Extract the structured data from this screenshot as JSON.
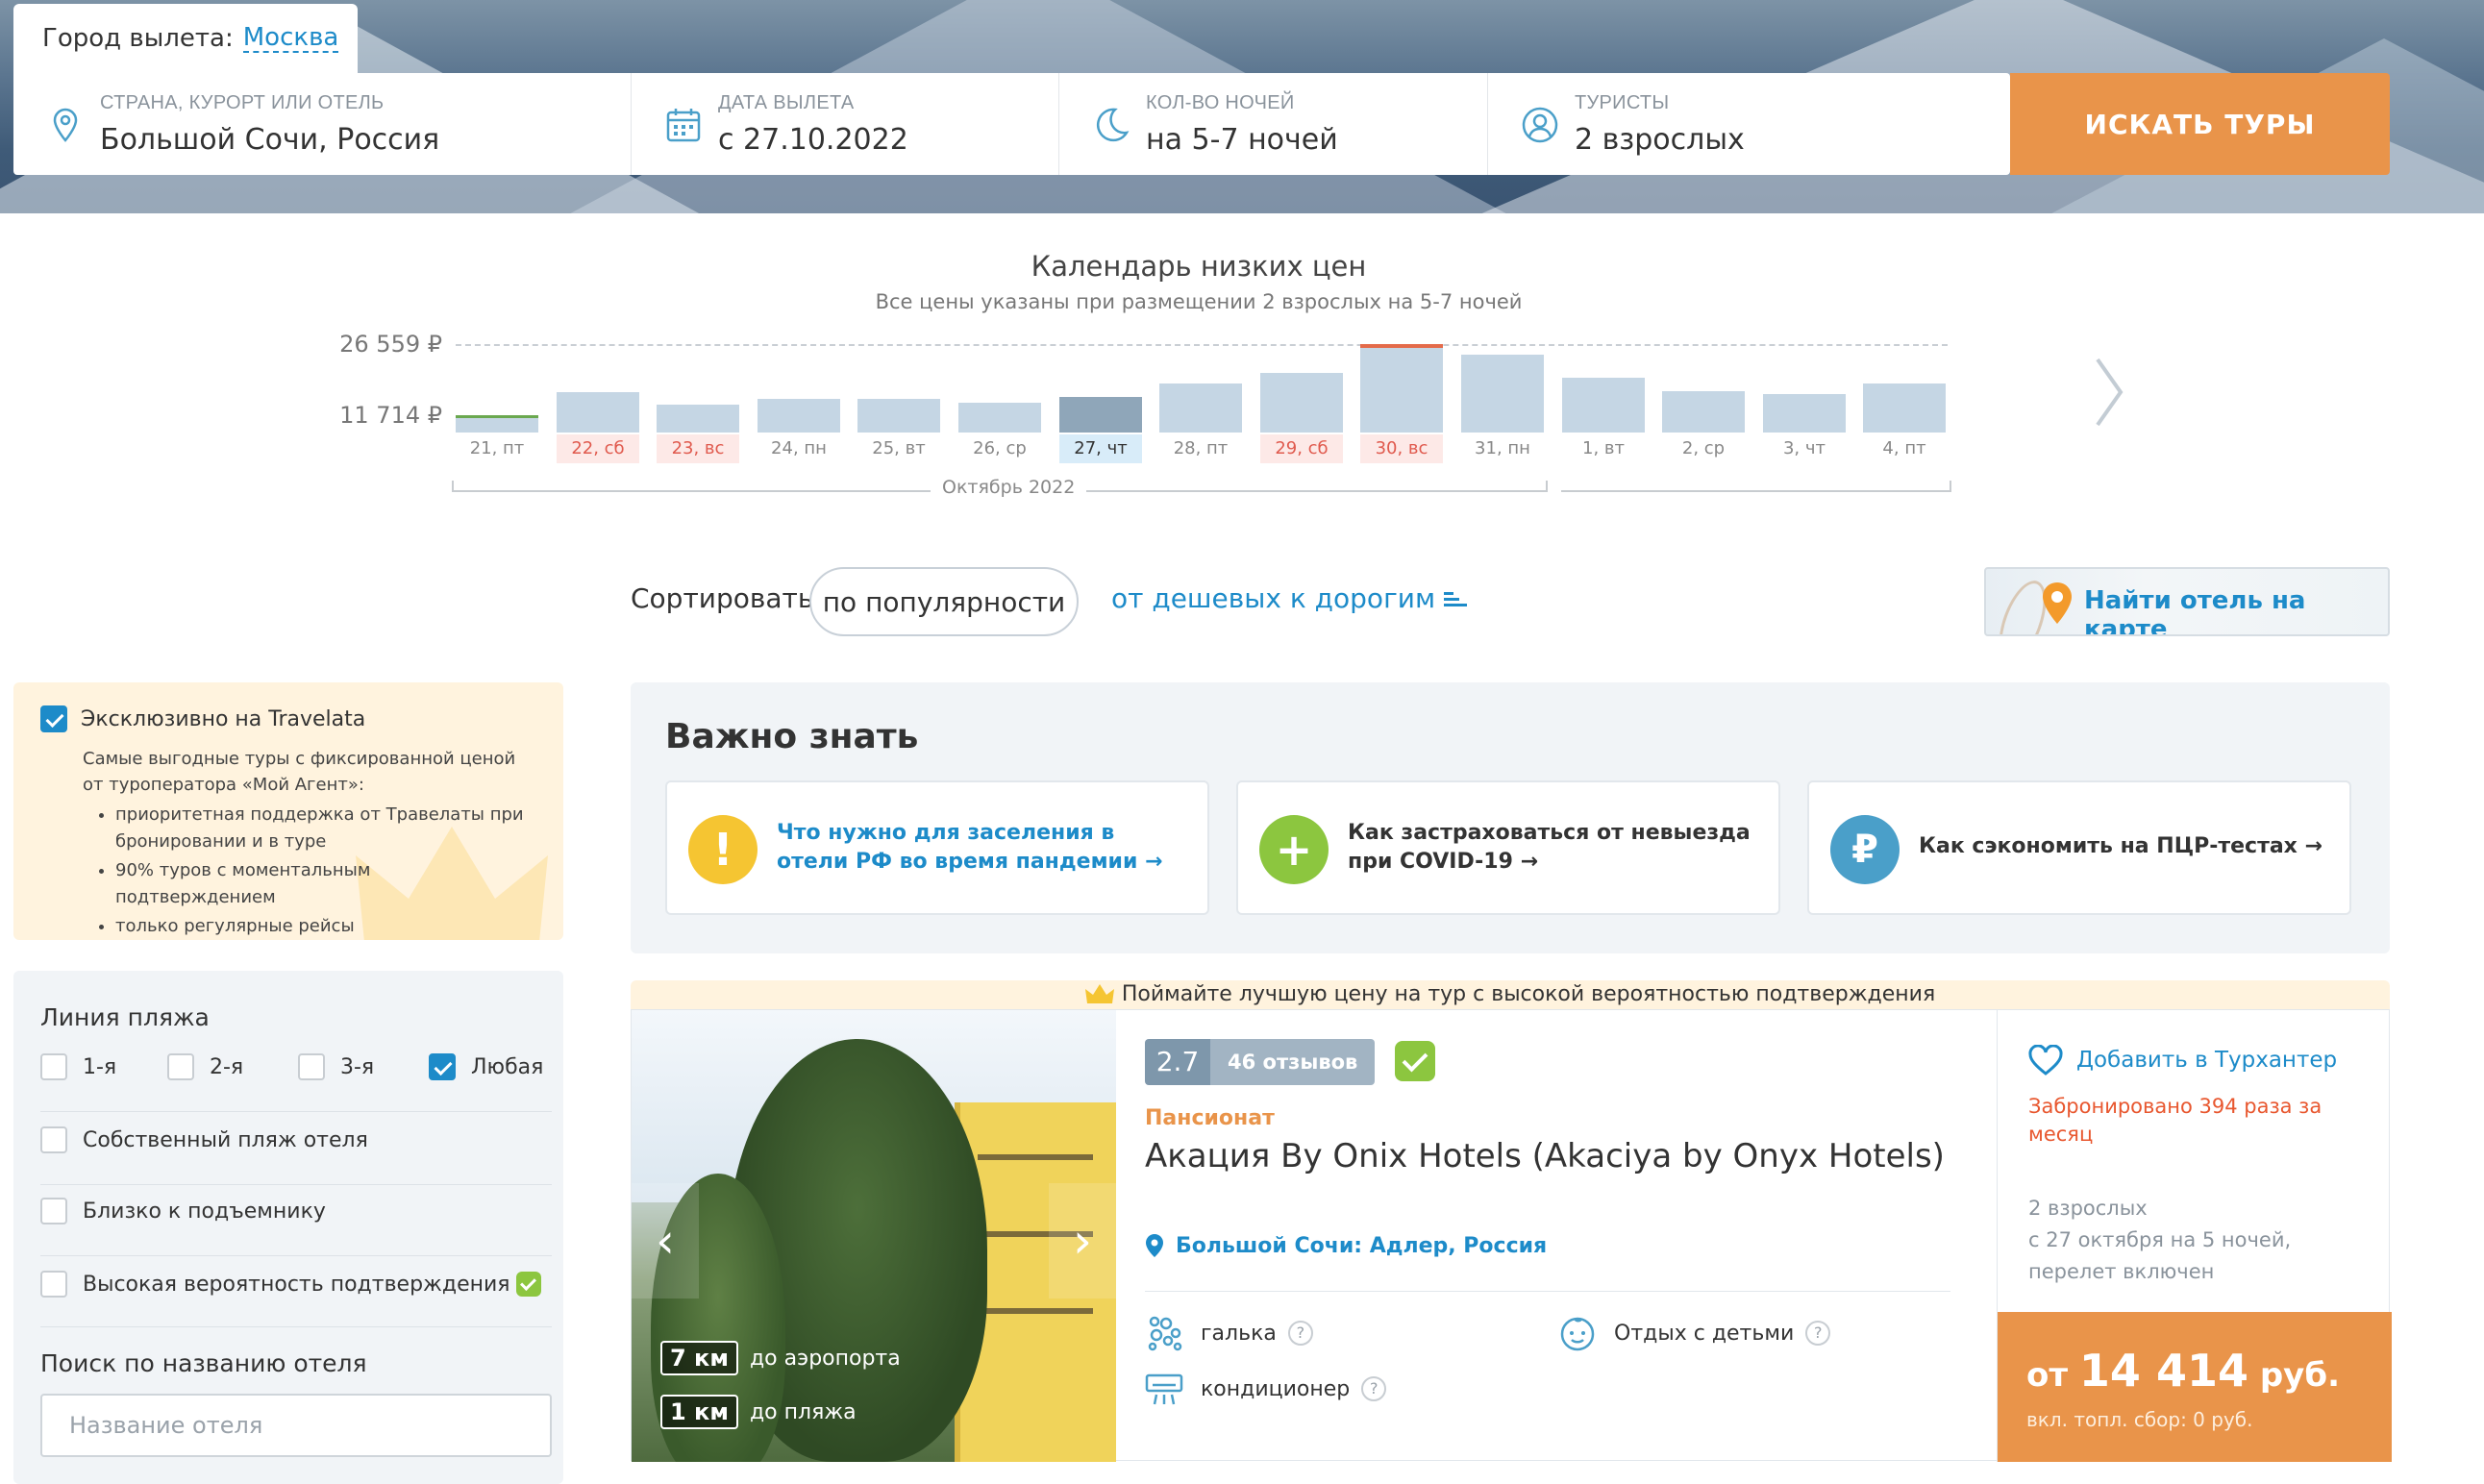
{
  "header": {
    "departure_label": "Город вылета:",
    "departure_city": "Москва",
    "fields": [
      {
        "label": "Страна, курорт или отель",
        "value": "Большой Сочи, Россия",
        "icon": "location-pin-icon"
      },
      {
        "label": "Дата вылета",
        "value": "с 27.10.2022",
        "icon": "calendar-icon"
      },
      {
        "label": "Кол-во ночей",
        "value": "на 5-7 ночей",
        "icon": "moon-icon"
      },
      {
        "label": "Туристы",
        "value": "2 взрослых",
        "icon": "user-icon"
      }
    ],
    "search_button": "ИСКАТЬ ТУРЫ",
    "accent_color": "#e9944a",
    "link_color": "#1d8bc9"
  },
  "calendar": {
    "title": "Календарь низких цен",
    "subtitle": "Все цены указаны при размещении 2 взрослых на 5-7 ночей",
    "price_max": "26 559 ₽",
    "price_min": "11 714 ₽",
    "month": "Октябрь 2022",
    "days": [
      {
        "label": "21, пт",
        "price": 11714,
        "weekend": false,
        "selected": false,
        "marker": "min"
      },
      {
        "label": "22, сб",
        "price": 16500,
        "weekend": true,
        "selected": false,
        "marker": ""
      },
      {
        "label": "23, вс",
        "price": 13900,
        "weekend": true,
        "selected": false,
        "marker": ""
      },
      {
        "label": "24, пн",
        "price": 15200,
        "weekend": false,
        "selected": false,
        "marker": ""
      },
      {
        "label": "25, вт",
        "price": 15200,
        "weekend": false,
        "selected": false,
        "marker": ""
      },
      {
        "label": "26, ср",
        "price": 14400,
        "weekend": false,
        "selected": false,
        "marker": ""
      },
      {
        "label": "27, чт",
        "price": 15500,
        "weekend": false,
        "selected": true,
        "marker": ""
      },
      {
        "label": "28, пт",
        "price": 18300,
        "weekend": false,
        "selected": false,
        "marker": ""
      },
      {
        "label": "29, сб",
        "price": 20500,
        "weekend": true,
        "selected": false,
        "marker": ""
      },
      {
        "label": "30, вс",
        "price": 26559,
        "weekend": true,
        "selected": false,
        "marker": "max"
      },
      {
        "label": "31, пн",
        "price": 24300,
        "weekend": false,
        "selected": false,
        "marker": ""
      },
      {
        "label": "1, вт",
        "price": 19500,
        "weekend": false,
        "selected": false,
        "marker": ""
      },
      {
        "label": "2, ср",
        "price": 16800,
        "weekend": false,
        "selected": false,
        "marker": ""
      },
      {
        "label": "3, чт",
        "price": 16200,
        "weekend": false,
        "selected": false,
        "marker": ""
      },
      {
        "label": "4, пт",
        "price": 18300,
        "weekend": false,
        "selected": false,
        "marker": ""
      }
    ]
  },
  "sort": {
    "label": "Сортировать:",
    "active": "по популярности",
    "alternative": "от дешевых к дорогим",
    "map_button": "Найти отель на карте"
  },
  "exclusive": {
    "title": "Эксклюзивно на Travelata",
    "checked": true,
    "description": "Самые выгодные туры с фиксированной ценой от туроператора «Мой Агент»:",
    "bullets": [
      "приоритетная поддержка от Травелаты при бронировании и в туре",
      "90% туров с моментальным подтверждением",
      "только регулярные рейсы"
    ]
  },
  "filters": {
    "beach_title": "Линия пляжа",
    "beach_options": [
      {
        "label": "1-я",
        "checked": false
      },
      {
        "label": "2-я",
        "checked": false
      },
      {
        "label": "3-я",
        "checked": false
      },
      {
        "label": "Любая",
        "checked": true
      }
    ],
    "checkboxes": [
      {
        "label": "Собственный пляж отеля",
        "checked": false
      },
      {
        "label": "Близко к подъемнику",
        "checked": false
      },
      {
        "label": "Высокая вероятность подтверждения",
        "checked": false
      }
    ],
    "name_search_title": "Поиск по названию отеля",
    "name_search_placeholder": "Название отеля"
  },
  "important": {
    "title": "Важно знать",
    "cards": [
      {
        "text": "Что нужно для заселения в отели РФ во время пандемии →",
        "icon": "exclamation-icon",
        "color": "#f5c532"
      },
      {
        "text": "Как застраховаться от невыезда при COVID-19 →",
        "icon": "plus-icon",
        "color": "#8cc63f"
      },
      {
        "text": "Как сэкономить на ПЦР-тестах →",
        "icon": "ruble-icon",
        "color": "#4a9fc9"
      }
    ]
  },
  "hotel": {
    "promo": "Поймайте лучшую цену на тур с высокой вероятностью подтверждения",
    "rating": "2.7",
    "reviews": "46 отзывов",
    "type": "Пансионат",
    "name": "Акация By Onix Hotels (Akaciya by Onyx Hotels)",
    "location": "Большой Сочи: Адлер, Россия",
    "distances": [
      {
        "value": "7 км",
        "label": "до аэропорта"
      },
      {
        "value": "1 км",
        "label": "до пляжа"
      }
    ],
    "amenities": [
      {
        "label": "галька",
        "icon": "pebbles-icon"
      },
      {
        "label": "Отдых с детьми",
        "icon": "baby-icon"
      },
      {
        "label": "кондиционер",
        "icon": "air-conditioner-icon"
      }
    ],
    "help_mark": "?",
    "favorite": "Добавить в Турхантер",
    "booked": "Забронировано 394 раза за месяц",
    "trip_lines": [
      "2 взрослых",
      "с 27 октября на 5 ночей,",
      "перелет включен"
    ],
    "price_prefix": "от",
    "price_value": "14 414",
    "price_currency": "руб.",
    "fee": "вкл. топл. сбор: 0 руб."
  }
}
